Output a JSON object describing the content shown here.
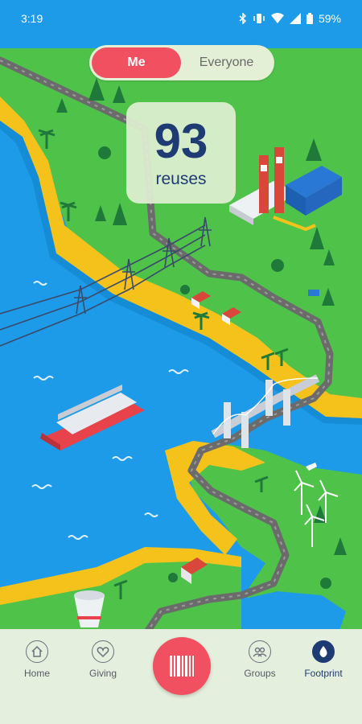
{
  "status_bar": {
    "time": "3:19",
    "battery": "59%",
    "icons": [
      "bluetooth-icon",
      "vibrate-icon",
      "wifi-icon",
      "signal-icon",
      "battery-icon"
    ]
  },
  "toggle": {
    "me_label": "Me",
    "everyone_label": "Everyone",
    "selected": "Me"
  },
  "reuse_card": {
    "count": "93",
    "label": "reuses"
  },
  "nav": {
    "items": [
      {
        "label": "Home",
        "icon": "home-icon"
      },
      {
        "label": "Giving",
        "icon": "heart-icon"
      },
      {
        "label": "Groups",
        "icon": "groups-icon"
      },
      {
        "label": "Footprint",
        "icon": "droplet-icon"
      }
    ],
    "active": "Footprint",
    "scan_icon": "barcode-icon"
  },
  "colors": {
    "accent": "#f0505f",
    "navy": "#1f3b73",
    "water": "#1e9be8",
    "land": "#4fc24a",
    "sand": "#f5c21b"
  }
}
